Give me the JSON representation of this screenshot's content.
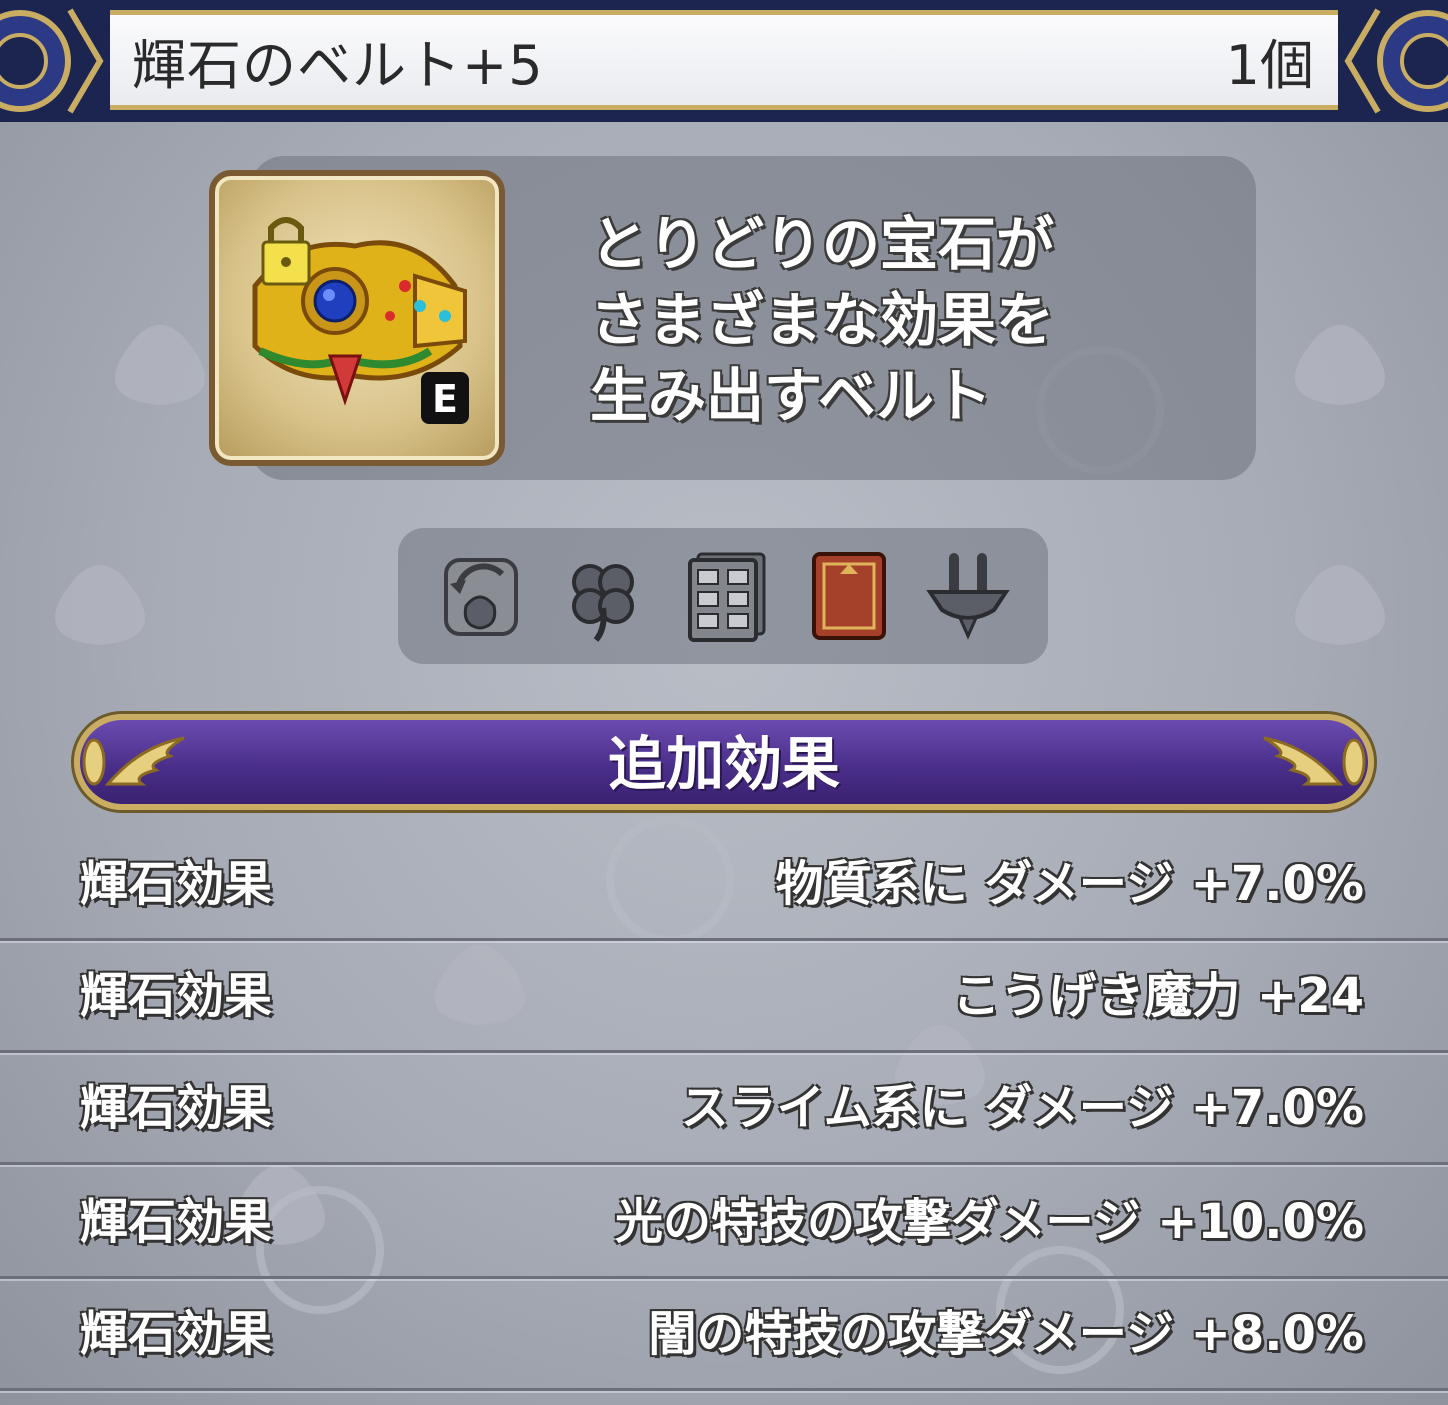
{
  "header": {
    "item_name": "輝石のベルト+5",
    "count": "1個"
  },
  "item": {
    "icon": "jeweled-belt-icon",
    "equipped_badge": "E",
    "description": [
      "とりどりの宝石が",
      "さまざまな効果を",
      "生み出すベルト"
    ]
  },
  "attributes": [
    {
      "icon": "trade-bag-icon"
    },
    {
      "icon": "clover-icon"
    },
    {
      "icon": "storage-cabinet-icon"
    },
    {
      "icon": "book-icon"
    },
    {
      "icon": "anvil-icon"
    }
  ],
  "section": {
    "title": "追加効果"
  },
  "effects": [
    {
      "label": "輝石効果",
      "value": "物質系に ダメージ +7.0%"
    },
    {
      "label": "輝石効果",
      "value": "こうげき魔力 +24"
    },
    {
      "label": "輝石効果",
      "value": "スライム系に ダメージ +7.0%"
    },
    {
      "label": "輝石効果",
      "value": "光の特技の攻撃ダメージ +10.0%"
    },
    {
      "label": "輝石効果",
      "value": "闇の特技の攻撃ダメージ +8.0%"
    }
  ],
  "colors": {
    "title_bar_navy": "#1b2550",
    "gold_trim": "#c9ad62",
    "section_purple": "#4a2f8a"
  }
}
